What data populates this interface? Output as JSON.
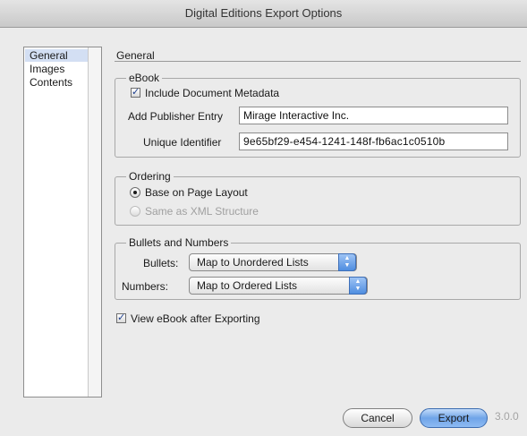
{
  "window": {
    "title": "Digital Editions Export Options"
  },
  "sidebar": {
    "items": [
      {
        "label": "General",
        "selected": true
      },
      {
        "label": "Images",
        "selected": false
      },
      {
        "label": "Contents",
        "selected": false
      }
    ]
  },
  "panel": {
    "title": "General"
  },
  "ebook": {
    "group_title": "eBook",
    "include_metadata": {
      "label": "Include Document Metadata",
      "checked": true
    },
    "publisher": {
      "label": "Add Publisher Entry",
      "value": "Mirage Interactive Inc."
    },
    "identifier": {
      "label": "Unique Identifier",
      "value": "9e65bf29-e454-1241-148f-fb6ac1c0510b"
    }
  },
  "ordering": {
    "group_title": "Ordering",
    "options": [
      {
        "label": "Base on Page Layout",
        "selected": true,
        "enabled": true
      },
      {
        "label": "Same as XML Structure",
        "selected": false,
        "enabled": false
      }
    ]
  },
  "bullets_numbers": {
    "group_title": "Bullets and Numbers",
    "bullets": {
      "label": "Bullets:",
      "value": "Map to Unordered Lists"
    },
    "numbers": {
      "label": "Numbers:",
      "value": "Map to Ordered Lists"
    }
  },
  "view_after": {
    "label": "View eBook after Exporting",
    "checked": true
  },
  "footer": {
    "cancel_label": "Cancel",
    "export_label": "Export",
    "version": "3.0.0"
  }
}
